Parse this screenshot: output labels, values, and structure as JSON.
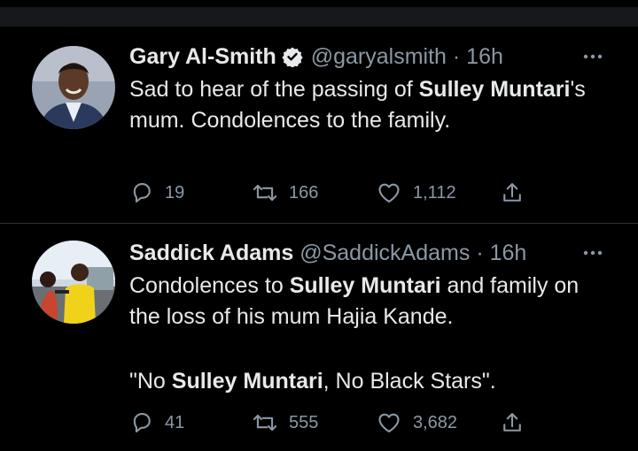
{
  "tweets": [
    {
      "name": "Gary Al-Smith",
      "verified": true,
      "handle": "@garyalsmith",
      "dot": "·",
      "time": "16h",
      "text_parts": [
        "Sad to hear of the passing of ",
        "Sulley Muntari",
        "'s mum. Condolences to the family."
      ],
      "replies": "19",
      "retweets": "166",
      "likes": "1,112"
    },
    {
      "name": "Saddick Adams",
      "verified": false,
      "handle": "@SaddickAdams",
      "dot": "·",
      "time": "16h",
      "text_parts": [
        "Condolences to ",
        "Sulley Muntari",
        " and family on the loss of his mum Hajia Kande."
      ],
      "quote_parts": [
        "\"No ",
        "Sulley Muntari",
        ", No Black Stars\"."
      ],
      "replies": "41",
      "retweets": "555",
      "likes": "3,682"
    }
  ],
  "colors": {
    "background": "#000000",
    "text": "#e7e9ea",
    "secondary": "#8b98a5",
    "divider": "#2f3336",
    "verified": "#e7e9ea"
  }
}
